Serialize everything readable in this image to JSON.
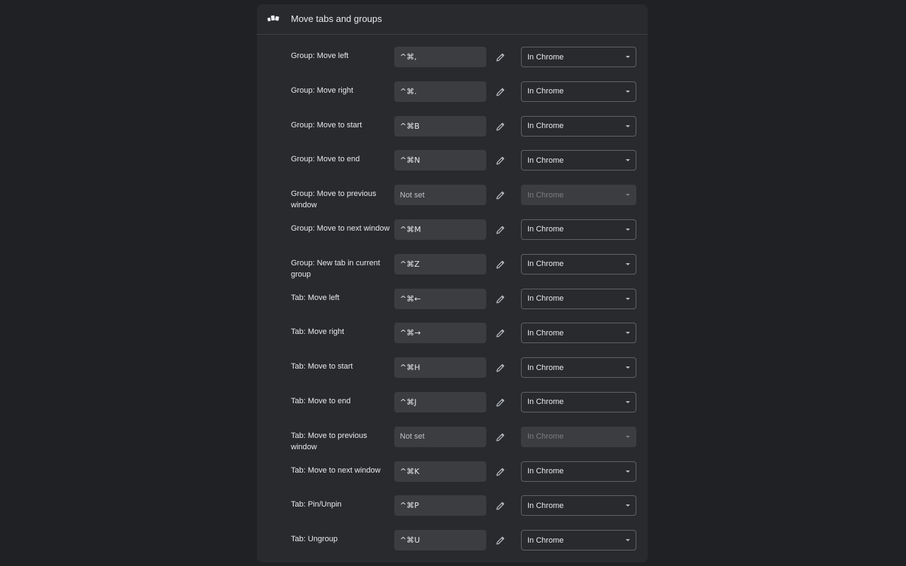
{
  "section": {
    "title": "Move tabs and groups",
    "icon": "extension-logo-icon"
  },
  "rows": [
    {
      "label": "Group: Move left",
      "shortcut": "^⌘,",
      "scope": "In Chrome",
      "enabled": true
    },
    {
      "label": "Group: Move right",
      "shortcut": "^⌘.",
      "scope": "In Chrome",
      "enabled": true
    },
    {
      "label": "Group: Move to start",
      "shortcut": "^⌘B",
      "scope": "In Chrome",
      "enabled": true
    },
    {
      "label": "Group: Move to end",
      "shortcut": "^⌘N",
      "scope": "In Chrome",
      "enabled": true
    },
    {
      "label": "Group: Move to previous window",
      "shortcut": "Not set",
      "scope": "In Chrome",
      "enabled": false
    },
    {
      "label": "Group: Move to next window",
      "shortcut": "^⌘M",
      "scope": "In Chrome",
      "enabled": true
    },
    {
      "label": "Group: New tab in current group",
      "shortcut": "^⌘Z",
      "scope": "In Chrome",
      "enabled": true
    },
    {
      "label": "Tab: Move left",
      "shortcut": "^⌘←",
      "scope": "In Chrome",
      "enabled": true
    },
    {
      "label": "Tab: Move right",
      "shortcut": "^⌘→",
      "scope": "In Chrome",
      "enabled": true
    },
    {
      "label": "Tab: Move to start",
      "shortcut": "^⌘H",
      "scope": "In Chrome",
      "enabled": true
    },
    {
      "label": "Tab: Move to end",
      "shortcut": "^⌘J",
      "scope": "In Chrome",
      "enabled": true
    },
    {
      "label": "Tab: Move to previous window",
      "shortcut": "Not set",
      "scope": "In Chrome",
      "enabled": false
    },
    {
      "label": "Tab: Move to next window",
      "shortcut": "^⌘K",
      "scope": "In Chrome",
      "enabled": true
    },
    {
      "label": "Tab: Pin/Unpin",
      "shortcut": "^⌘P",
      "scope": "In Chrome",
      "enabled": true
    },
    {
      "label": "Tab: Ungroup",
      "shortcut": "^⌘U",
      "scope": "In Chrome",
      "enabled": true
    }
  ],
  "colors": {
    "background": "#202124",
    "card": "#292a2d",
    "field": "#3c3d40",
    "text": "#e8eaed",
    "disabled_text": "#7b7e82"
  }
}
